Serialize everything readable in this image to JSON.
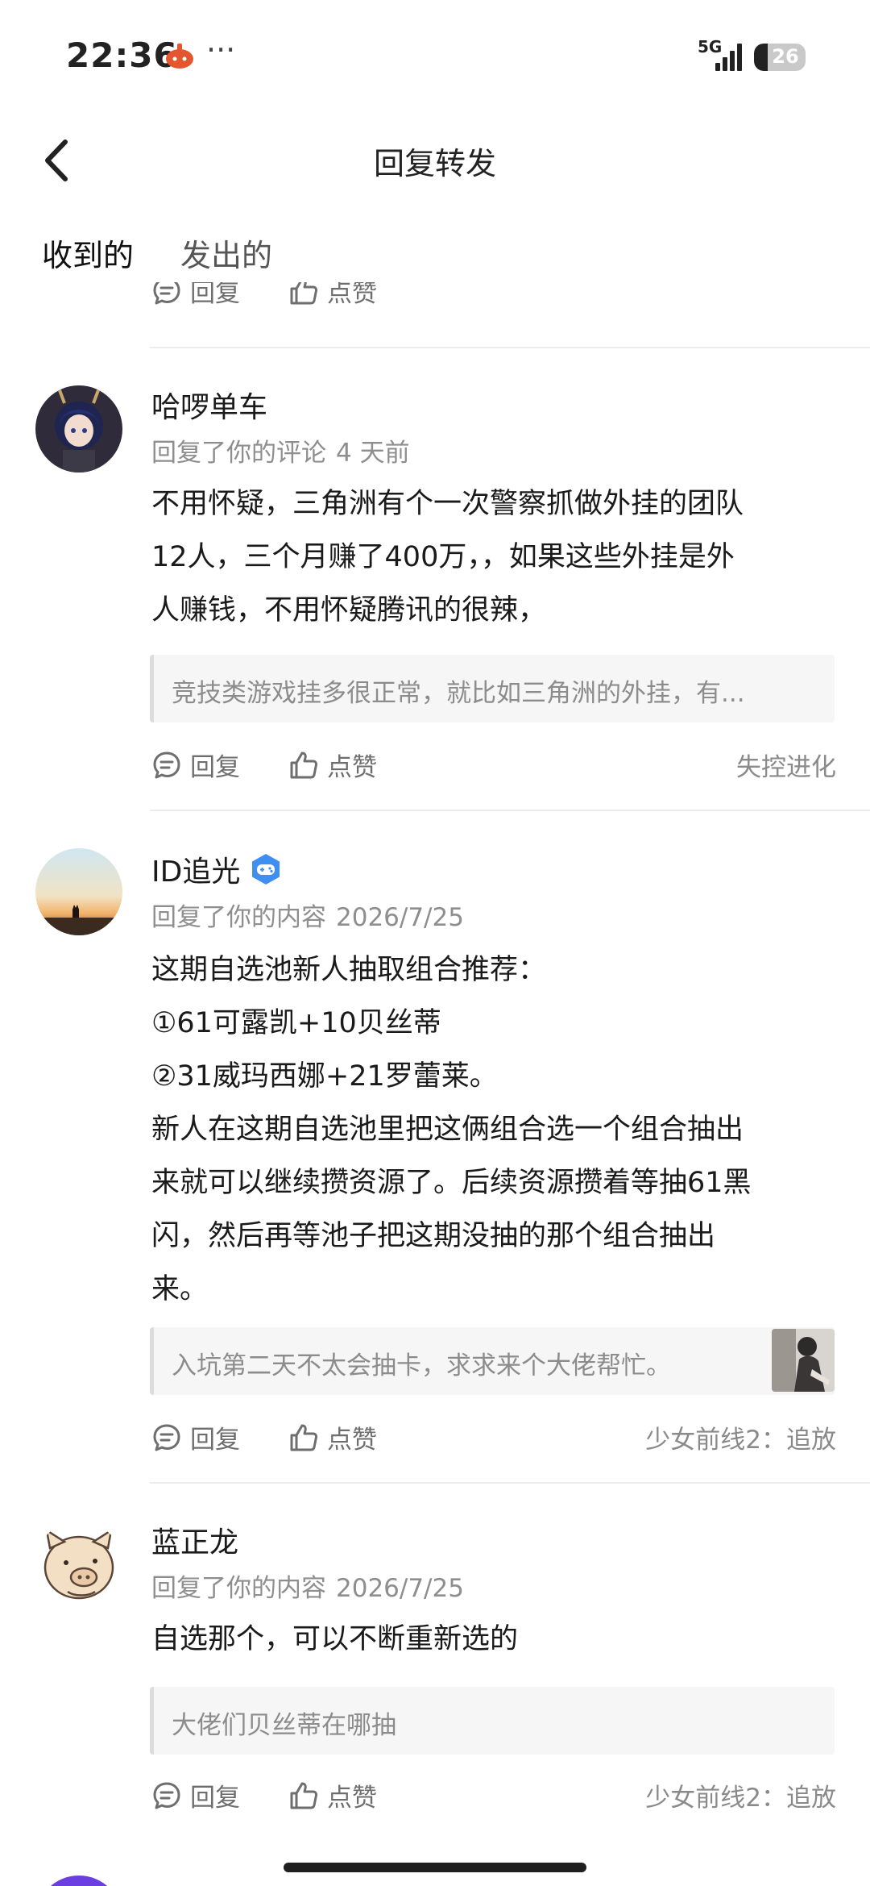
{
  "status_bar": {
    "time": "22:36",
    "more": "···",
    "network": "5G",
    "battery": "26",
    "battery_level": 0.26
  },
  "header": {
    "title": "回复转发",
    "back_icon": "chevron-left-icon"
  },
  "tabs": [
    {
      "label": "收到的",
      "active": true
    },
    {
      "label": "发出的",
      "active": false
    }
  ],
  "actions": {
    "reply": "回复",
    "like": "点赞"
  },
  "items": [
    {
      "name": "哈啰单车",
      "action": "回复了你的评论",
      "time": "4 天前",
      "lines": [
        "不用怀疑，三角洲有个一次警察抓做外挂的团队",
        "12人，三个月赚了400万，，如果这些外挂是外",
        "人赚钱，不用怀疑腾讯的很辣，"
      ],
      "quote": "竞技类游戏挂多很正常，就比如三角洲的外挂，有...",
      "source": "失控进化"
    },
    {
      "name": "ID追光",
      "badge_icon": "game-controller-badge-icon",
      "action": "回复了你的内容",
      "time": "2026/7/25",
      "lines": [
        "这期自选池新人抽取组合推荐：",
        "①61可露凯+10贝丝蒂",
        "②31威玛西娜+21罗蕾莱。",
        "新人在这期自选池里把这俩组合选一个组合抽出",
        "来就可以继续攒资源了。后续资源攒着等抽61黑",
        "闪，然后再等池子把这期没抽的那个组合抽出",
        "来。"
      ],
      "quote": "入坑第二天不太会抽卡，求求来个大佬帮忙。",
      "source": "少女前线2：追放"
    },
    {
      "name": "蓝正龙",
      "action": "回复了你的内容",
      "time": "2026/7/25",
      "lines": [
        "自选那个，可以不断重新选的"
      ],
      "quote": "大佬们贝丝蒂在哪抽",
      "source": "少女前线2：追放"
    }
  ]
}
